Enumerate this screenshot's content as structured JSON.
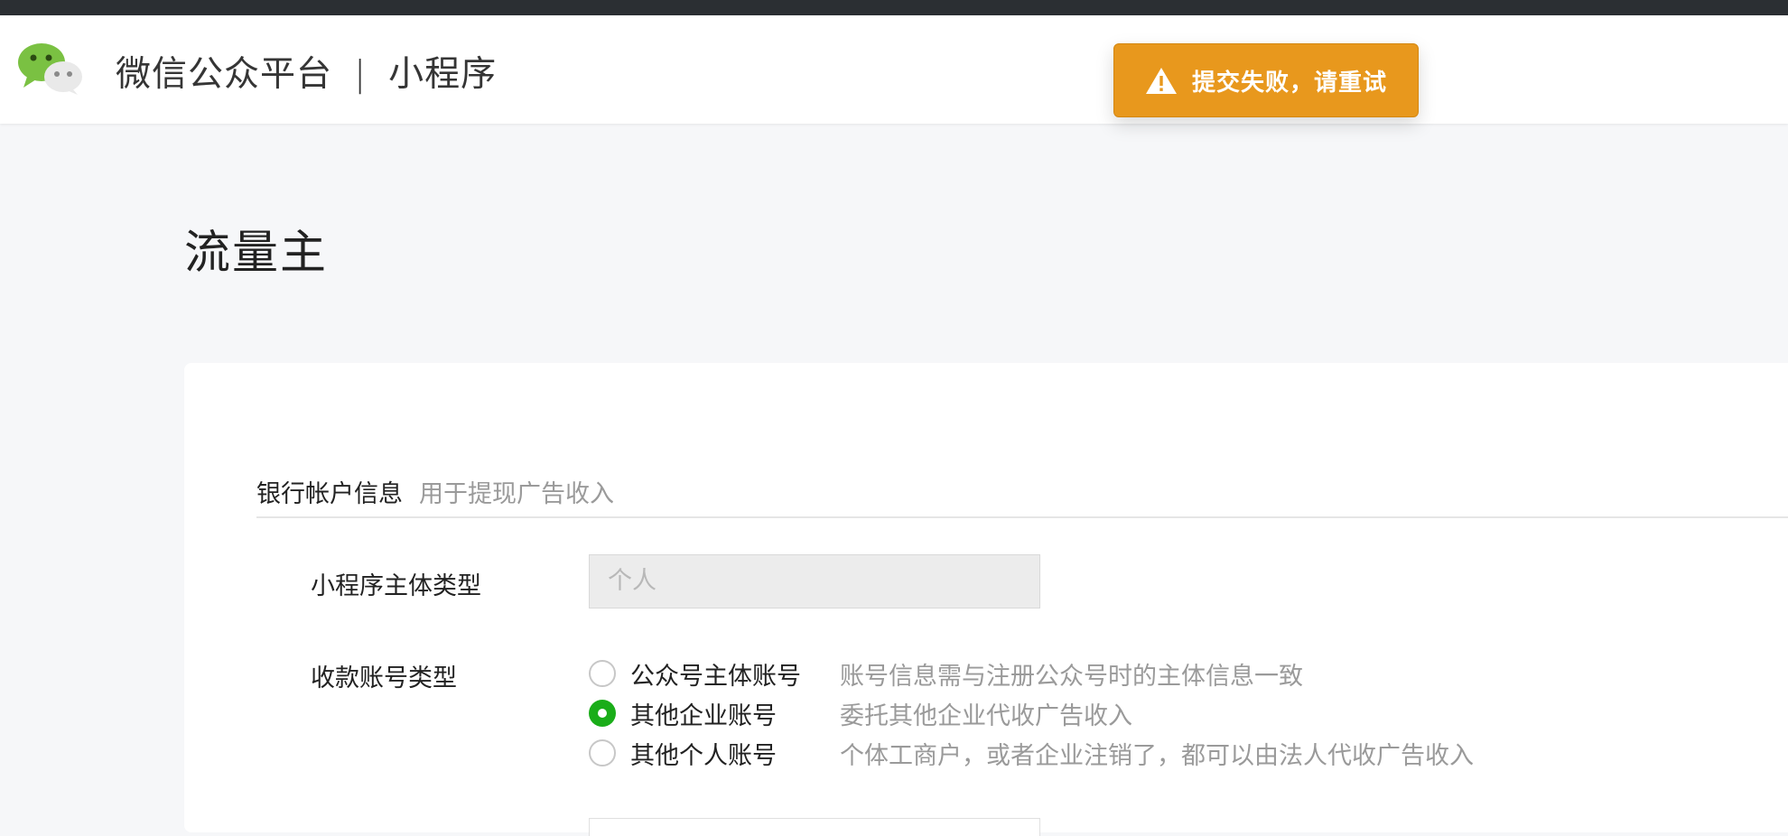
{
  "header": {
    "brand_name": "微信公众平台",
    "separator": "|",
    "product_name": "小程序"
  },
  "toast": {
    "message": "提交失败，请重试",
    "icon": "warning-icon",
    "color": "#e8981d"
  },
  "page": {
    "title": "流量主"
  },
  "section": {
    "title": "银行帐户信息",
    "description": "用于提现广告收入"
  },
  "form": {
    "entity_type": {
      "label": "小程序主体类型",
      "value": "个人"
    },
    "account_type": {
      "label": "收款账号类型",
      "options": [
        {
          "label": "公众号主体账号",
          "description": "账号信息需与注册公众号时的主体信息一致",
          "checked": false
        },
        {
          "label": "其他企业账号",
          "description": "委托其他企业代收广告收入",
          "checked": true
        },
        {
          "label": "其他个人账号",
          "description": "个体工商户，或者企业注销了，都可以由法人代收广告收入",
          "checked": false
        }
      ]
    }
  },
  "colors": {
    "accent": "#1aad19",
    "header_dark": "#2b2f33",
    "warning": "#e8981d"
  }
}
